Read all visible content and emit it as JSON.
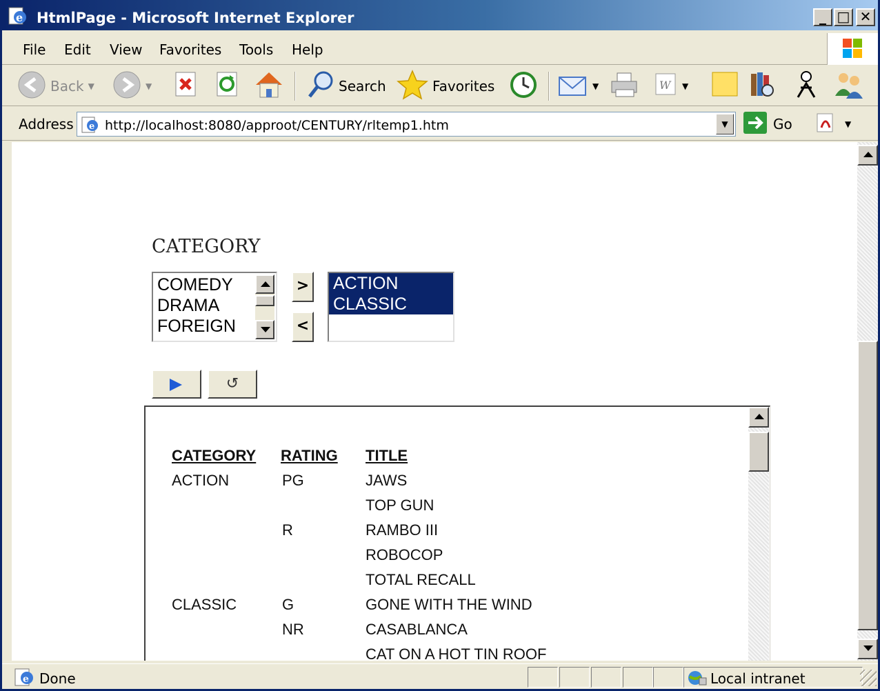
{
  "window": {
    "title": "HtmlPage - Microsoft Internet Explorer",
    "min_symbol": "_",
    "max_symbol": "□",
    "close_symbol": "✕"
  },
  "menu": {
    "items": [
      "File",
      "Edit",
      "View",
      "Favorites",
      "Tools",
      "Help"
    ]
  },
  "toolbar": {
    "back_label": "Back",
    "search_label": "Search",
    "favorites_label": "Favorites"
  },
  "address": {
    "label": "Address",
    "url": "http://localhost:8080/approot/CENTURY/rltemp1.htm",
    "go_label": "Go"
  },
  "page": {
    "category_label": "CATEGORY",
    "available_options": [
      "COMEDY",
      "DRAMA",
      "FOREIGN"
    ],
    "selected_options": [
      "ACTION",
      "CLASSIC"
    ],
    "move_right_symbol": ">",
    "move_left_symbol": "<",
    "reset_symbol": "↺"
  },
  "report": {
    "headers": [
      "CATEGORY",
      "RATING",
      "TITLE"
    ],
    "rows": [
      {
        "category": "ACTION",
        "rating": "PG",
        "title": "JAWS"
      },
      {
        "category": "",
        "rating": "",
        "title": "TOP GUN"
      },
      {
        "category": "",
        "rating": "R",
        "title": "RAMBO III"
      },
      {
        "category": "",
        "rating": "",
        "title": "ROBOCOP"
      },
      {
        "category": "",
        "rating": "",
        "title": "TOTAL RECALL"
      },
      {
        "category": "CLASSIC",
        "rating": "G",
        "title": "GONE WITH THE WIND"
      },
      {
        "category": "",
        "rating": "NR",
        "title": "CASABLANCA"
      },
      {
        "category": "",
        "rating": "",
        "title": "CAT ON A HOT TIN ROOF"
      }
    ]
  },
  "status": {
    "text": "Done",
    "zone": "Local intranet"
  },
  "colors": {
    "titlebar": "#0a246a",
    "selection": "#0a246a",
    "run_arrow": "#1f5bd6"
  }
}
